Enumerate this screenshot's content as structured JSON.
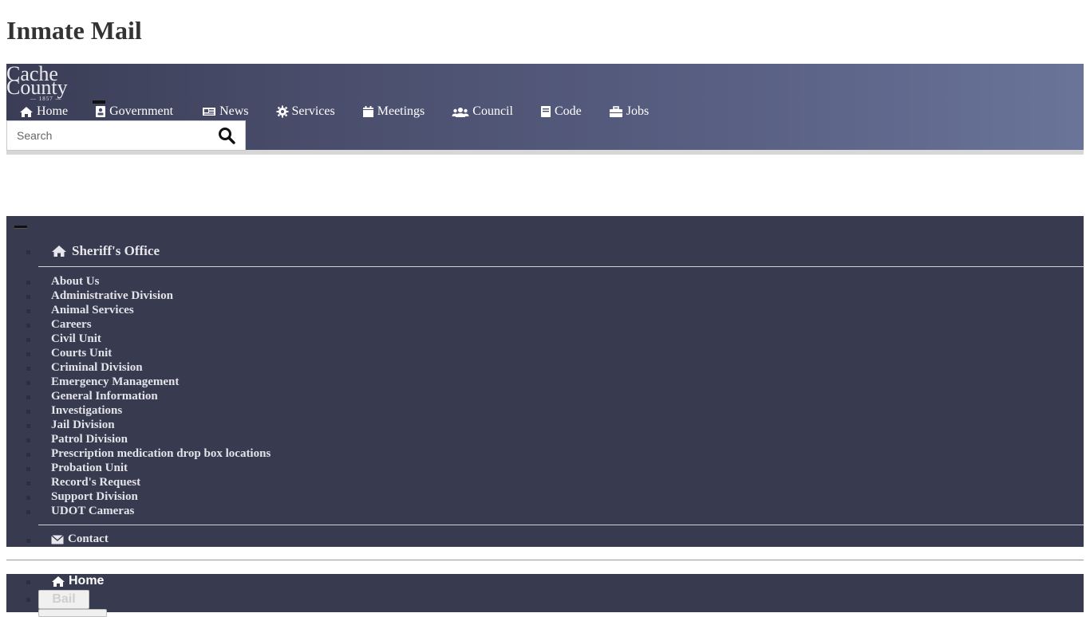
{
  "page": {
    "title": "Inmate Mail"
  },
  "logo": {
    "line1": "Cache",
    "line2": "County",
    "est": "1857"
  },
  "topnav": {
    "items": [
      {
        "label": "Home",
        "icon": "home-icon"
      },
      {
        "label": "Government",
        "icon": "id-card-icon"
      },
      {
        "label": "News",
        "icon": "newspaper-icon"
      },
      {
        "label": "Services",
        "icon": "gear-icon"
      },
      {
        "label": "Meetings",
        "icon": "calendar-icon"
      },
      {
        "label": "Council",
        "icon": "users-icon"
      },
      {
        "label": "Code",
        "icon": "book-icon"
      },
      {
        "label": "Jobs",
        "icon": "briefcase-icon"
      }
    ]
  },
  "search": {
    "placeholder": "Search",
    "value": ""
  },
  "sidebar": {
    "heading": "Sheriff's Office",
    "links": [
      "About Us",
      "Administrative Division",
      "Animal Services",
      "Careers",
      "Civil Unit",
      "Courts Unit",
      "Criminal Division",
      "Emergency Management",
      "General Information",
      "Investigations",
      "Jail Division",
      "Patrol Division",
      "Prescription medication drop box locations",
      "Probation Unit",
      "Record's Request",
      "Support Division",
      "UDOT Cameras"
    ],
    "contact": "Contact"
  },
  "bottom_nav": {
    "home": "Home",
    "bail": "Bail"
  },
  "colors": {
    "header_start": "#3a3d55",
    "header_end": "#6a7499",
    "panel": "#383a4f",
    "text_light": "#e6e6ec"
  }
}
